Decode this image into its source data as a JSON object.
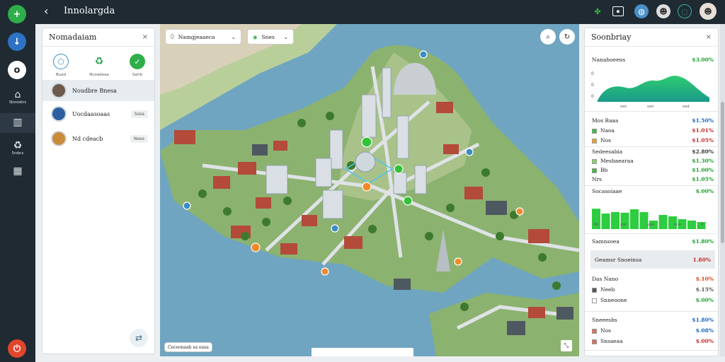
{
  "topbar": {
    "title": "Innolargda",
    "back_icon": "chevron-left-icon"
  },
  "rail": {
    "items": [
      {
        "label": "Sbosiabrs",
        "icon": "chat-icon"
      },
      {
        "label": "",
        "icon": "library-icon"
      },
      {
        "label": "Srobcs",
        "icon": "recycle-icon"
      },
      {
        "label": "",
        "icon": "grid-icon"
      }
    ]
  },
  "left_panel": {
    "title": "Nomadaiam",
    "quick_actions": [
      {
        "label": "Buad",
        "icon": "pentagon-icon"
      },
      {
        "label": "Ncoadeaa",
        "icon": "recycle-icon"
      },
      {
        "label": "Sairb",
        "icon": "check-icon"
      }
    ],
    "contacts": [
      {
        "name": "Noudbre Bnesa",
        "tag": ""
      },
      {
        "name": "Uocdaasoaas",
        "tag": "Sosa"
      },
      {
        "name": "Nd cdeacb",
        "tag": "Nees"
      }
    ]
  },
  "map": {
    "filter_label": "Namgjeaaeca",
    "layer_label": "Snes",
    "scale_label": "Ceceonaab sa easa"
  },
  "right_panel": {
    "title": "Soonbriay",
    "summary": {
      "label": "Nanahoeens",
      "value": "$3.00%"
    },
    "chart1_ticks": [
      "0",
      "0",
      "0"
    ],
    "chart1_xlabels": [
      "sxn",
      "sxn",
      "sxd"
    ],
    "group1": [
      {
        "label": "Mos Baaa",
        "value": "$1.50%",
        "color": "#1565c0",
        "marker": ""
      },
      {
        "label": "Naoa",
        "value": "$1.01%",
        "color": "#c62828",
        "marker": "#34c23a"
      },
      {
        "label": "Nos",
        "value": "$1.05%",
        "color": "#c62828",
        "marker": "#f0a020"
      }
    ],
    "group2": [
      {
        "label": "Sedeesabia",
        "value": "$2.80%",
        "color": "#333",
        "marker": ""
      },
      {
        "label": "Mesbaearaa",
        "value": "$1.30%",
        "color": "#1b9e2a",
        "marker": "#7ed957"
      },
      {
        "label": "Bb",
        "value": "$1.00%",
        "color": "#1b9e2a",
        "marker": "#34c23a"
      },
      {
        "label": "Nrs",
        "value": "$1.05%",
        "color": "#1b9e2a",
        "marker": ""
      }
    ],
    "chart2": {
      "label": "Socasoiaae",
      "value": "$.00%",
      "values": [
        0.72,
        0.55,
        0.6,
        0.58,
        0.7,
        0.6,
        0.3,
        0.5,
        0.45,
        0.35,
        0.3,
        0.25
      ],
      "x": [
        "0b",
        "sre",
        "sao",
        "sne",
        "0"
      ]
    },
    "group3": [
      {
        "label": "Samnsoea",
        "value": "$1.80%",
        "color": "#1b9e2a"
      },
      {
        "label": "Geamsr Snoeinsa",
        "value": "1.80%",
        "color": "#c62828"
      }
    ],
    "group4": [
      {
        "label": "Das Nano",
        "value": "$.10%",
        "color": "#d84315",
        "marker": ""
      },
      {
        "label": "Neeb",
        "value": "$.15%",
        "color": "#555",
        "marker": "#555"
      },
      {
        "label": "Snneoone",
        "value": "$.00%",
        "color": "#1b9e2a",
        "marker": "#fff"
      }
    ],
    "group5": [
      {
        "label": "Sneeesbs",
        "value": "$1.80%",
        "color": "#1565c0",
        "marker": ""
      },
      {
        "label": "Nos",
        "value": "$.08%",
        "color": "#1565c0",
        "marker": "#e07050"
      },
      {
        "label": "Snsaeaa",
        "value": "$.00%",
        "color": "#c62828",
        "marker": "#e07050"
      }
    ]
  }
}
